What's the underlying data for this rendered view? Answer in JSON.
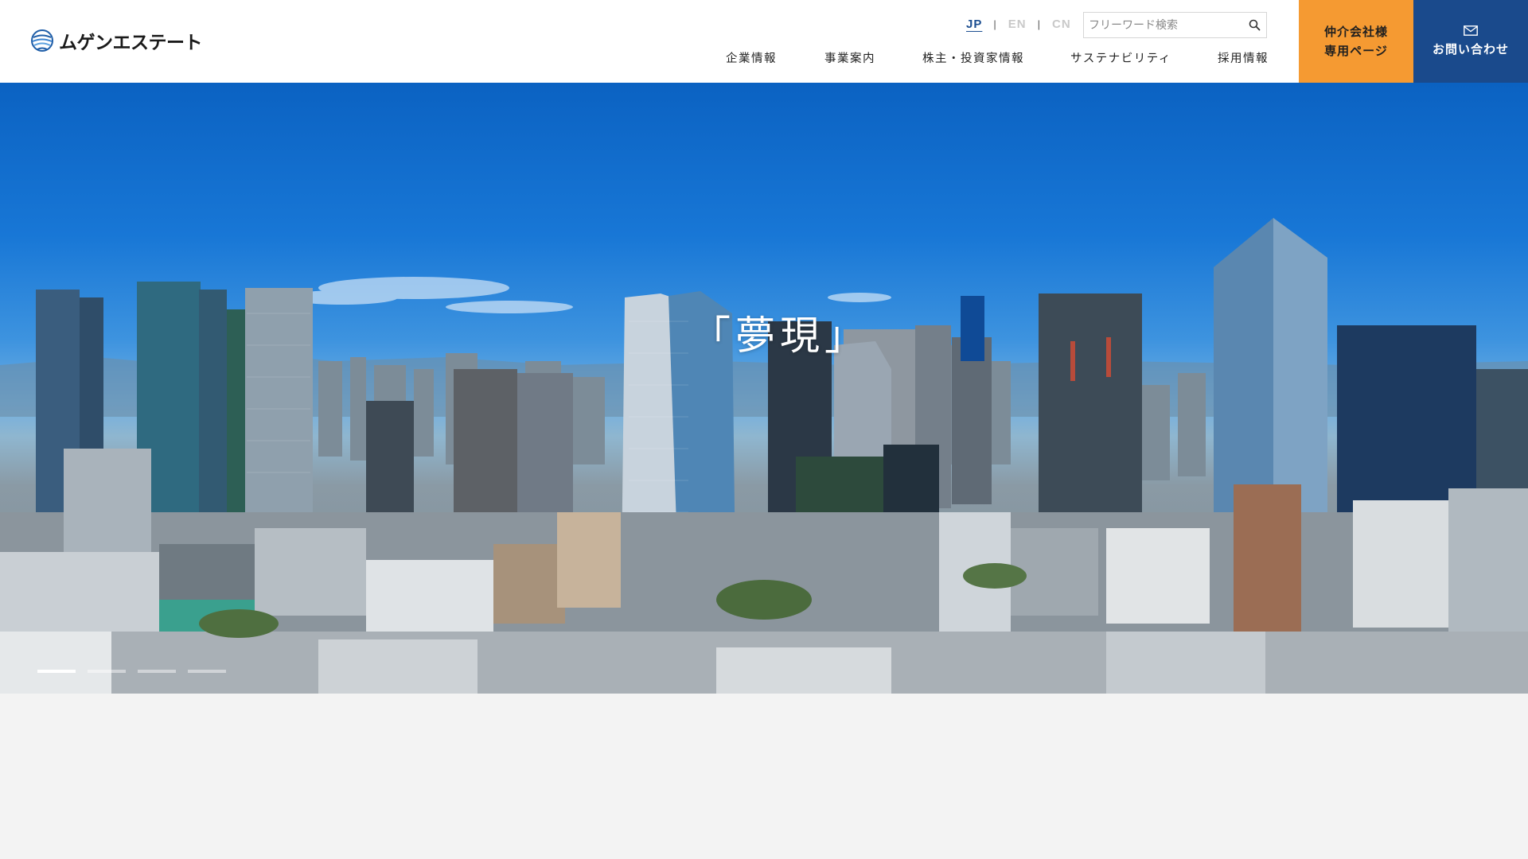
{
  "header": {
    "logo_text": "ムゲンエステート",
    "languages": [
      {
        "label": "JP",
        "active": true
      },
      {
        "label": "EN",
        "active": false
      },
      {
        "label": "CN",
        "active": false
      }
    ],
    "search": {
      "placeholder": "フリーワード検索",
      "icon": "search-icon"
    },
    "nav": [
      "企業情報",
      "事業案内",
      "株主・投資家情報",
      "サステナビリティ",
      "採用情報"
    ],
    "broker_button": {
      "line1": "仲介会社様",
      "line2": "専用ページ"
    },
    "contact_button": {
      "label": "お問い合わせ",
      "icon": "mail-icon"
    }
  },
  "hero": {
    "headline": "「夢現」",
    "slides_total": 4,
    "active_slide": 1
  },
  "colors": {
    "accent_orange": "#f59a32",
    "brand_navy": "#1a4a8c",
    "active_lang": "#1d4f91"
  }
}
